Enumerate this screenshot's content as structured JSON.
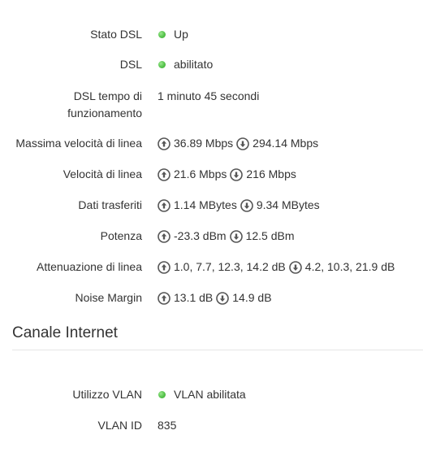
{
  "dsl": {
    "status": {
      "label": "Stato DSL",
      "value": "Up"
    },
    "dsl": {
      "label": "DSL",
      "value": "abilitato"
    },
    "uptime": {
      "label_line1": "DSL tempo di",
      "label_line2": "funzionamento",
      "value": "1 minuto 45 secondi"
    },
    "max_line_rate": {
      "label": "Massima velocità di linea",
      "up": "36.89 Mbps",
      "down": "294.14 Mbps"
    },
    "line_rate": {
      "label": "Velocità di linea",
      "up": "21.6 Mbps",
      "down": "216 Mbps"
    },
    "data_transferred": {
      "label": "Dati trasferiti",
      "up": "1.14 MBytes",
      "down": "9.34 MBytes"
    },
    "power": {
      "label": "Potenza",
      "up": "-23.3 dBm",
      "down": "12.5 dBm"
    },
    "line_attenuation": {
      "label": "Attenuazione di linea",
      "up": "1.0, 7.7, 12.3, 14.2 dB",
      "down": "4.2, 10.3, 21.9 dB"
    },
    "noise_margin": {
      "label": "Noise Margin",
      "up": "13.1 dB",
      "down": "14.9 dB"
    }
  },
  "internet": {
    "title": "Canale Internet",
    "vlan_usage": {
      "label": "Utilizzo VLAN",
      "value": "VLAN abilitata"
    },
    "vlan_id": {
      "label": "VLAN ID",
      "value": "835"
    }
  },
  "colors": {
    "status_green": "#55c24a",
    "text": "#333333",
    "icon": "#555555"
  },
  "icons": {
    "upload": "arrow-up-circle-icon",
    "download": "arrow-down-circle-icon",
    "status": "status-dot-icon"
  }
}
